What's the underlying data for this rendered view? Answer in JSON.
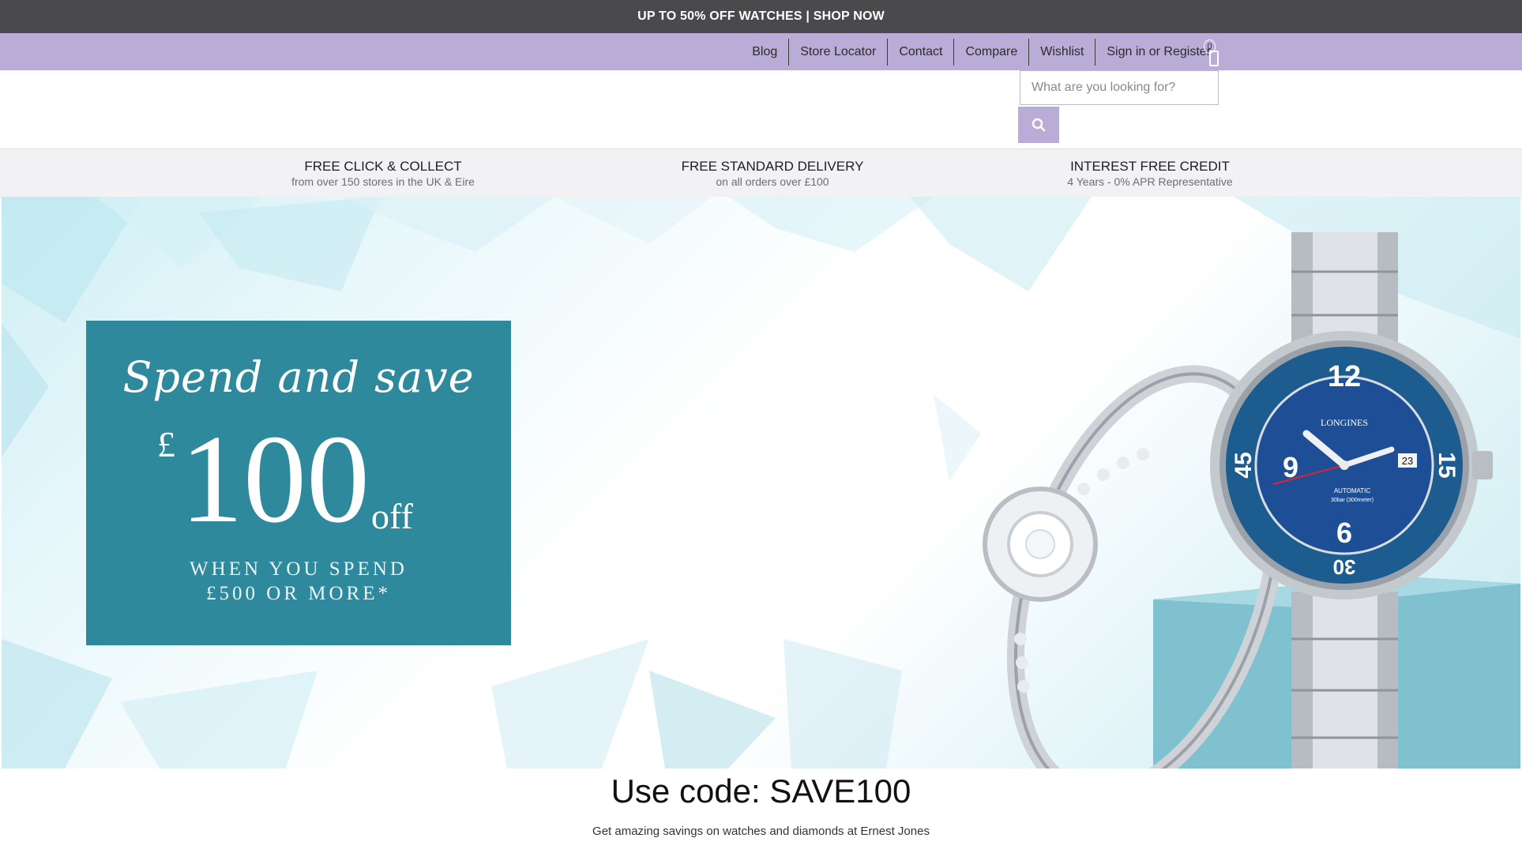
{
  "promo_bar": {
    "text": "UP TO 50% OFF WATCHES | SHOP NOW"
  },
  "utility_nav": {
    "items": [
      "Blog",
      "Store Locator",
      "Contact",
      "Compare",
      "Wishlist",
      "Sign in or Register"
    ],
    "cart_count": "0"
  },
  "search": {
    "placeholder": "What are you looking for?",
    "icon": "search-icon"
  },
  "benefits": [
    {
      "title": "FREE CLICK & COLLECT",
      "subtitle": "from over 150 stores in the UK & Eire"
    },
    {
      "title": "FREE STANDARD DELIVERY",
      "subtitle": "on all orders over £100"
    },
    {
      "title": "INTEREST FREE CREDIT",
      "subtitle": "4 Years - 0% APR Representative"
    }
  ],
  "hero": {
    "script_line": "Spend and save",
    "currency": "£",
    "amount": "100",
    "off": "off",
    "condition_line1": "WHEN YOU SPEND",
    "condition_line2": "£500 OR MORE*",
    "watch_brand": "LONGINES",
    "watch_line1": "AUTOMATIC",
    "watch_line2": "30bar (300meter)",
    "watch_date": "23",
    "bezel_numbers": [
      "12",
      "9",
      "6",
      "15",
      "45",
      "30"
    ]
  },
  "code": {
    "text": "Use code: SAVE100"
  },
  "tagline": {
    "text": "Get amazing savings on watches and diamonds at Ernest Jones"
  },
  "colors": {
    "promo_bar": "#4a4a4c",
    "accent": "#b9acd7",
    "hero_box": "#2f899c",
    "watch_dial": "#1e4f96"
  }
}
